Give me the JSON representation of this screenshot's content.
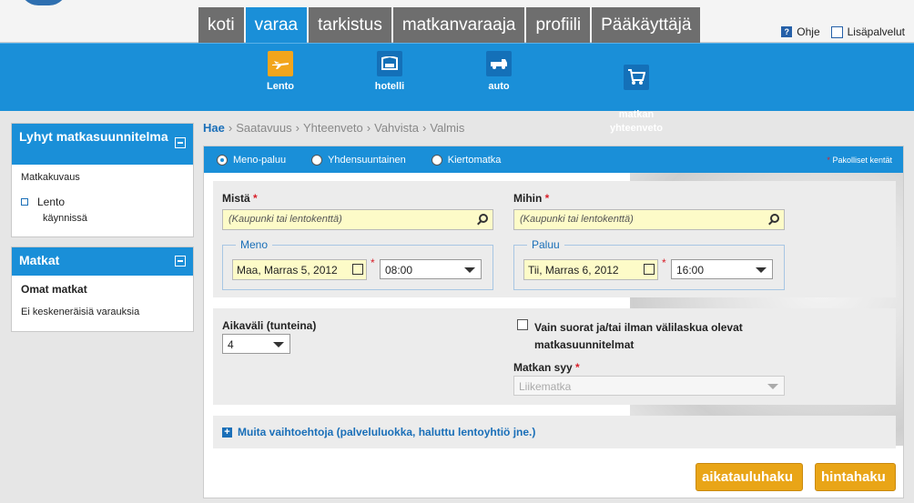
{
  "tabs": [
    "koti",
    "varaa",
    "tarkistus",
    "matkanvaraaja",
    "profiili",
    "Pääkäyttäjä"
  ],
  "help": {
    "ohje": "Ohje",
    "lisapalvelut": "Lisäpalvelut"
  },
  "subnav": [
    {
      "label": "Lento",
      "icon": "plane-icon"
    },
    {
      "label": "hotelli",
      "icon": "bed-icon"
    },
    {
      "label": "auto",
      "icon": "car-icon"
    },
    {
      "label": "matkan\nyhteenveto",
      "icon": "cart-icon"
    }
  ],
  "sidebar": {
    "trip_title": "Lyhyt matkasuunnitelma",
    "trip_desc": "Matkakuvaus",
    "trip_item": "Lento",
    "trip_status": "käynnissä",
    "trips_title": "Matkat",
    "my_trips": "Omat matkat",
    "no_bookings": "Ei keskeneräisiä varauksia"
  },
  "breadcrumb": [
    "Hae",
    "Saatavuus",
    "Yhteenveto",
    "Vahvista",
    "Valmis"
  ],
  "trip_types": [
    "Meno-paluu",
    "Yhdensuuntainen",
    "Kiertomatka"
  ],
  "required_note": "Pakolliset kentät",
  "form": {
    "from_label": "Mistä",
    "to_label": "Mihin",
    "from_placeholder": "(Kaupunki tai lentokenttä)",
    "to_placeholder": "(Kaupunki tai lentokenttä)",
    "depart_legend": "Meno",
    "return_legend": "Paluu",
    "depart_date": "Maa, Marras 5, 2012",
    "depart_time": "08:00",
    "return_date": "Tii, Marras 6, 2012",
    "return_time": "16:00",
    "window_label": "Aikaväli (tunteina)",
    "window_value": "4",
    "direct_label": "Vain suorat ja/tai ilman välilaskua olevat matkasuunnitelmat",
    "reason_label": "Matkan syy",
    "reason_value": "Liikematka",
    "more_options": "Muita vaihtoehtoja (palveluluokka, haluttu lentoyhtiö jne.)"
  },
  "buttons": {
    "schedule": "aikatauluhaku",
    "price": "hintahaku"
  }
}
